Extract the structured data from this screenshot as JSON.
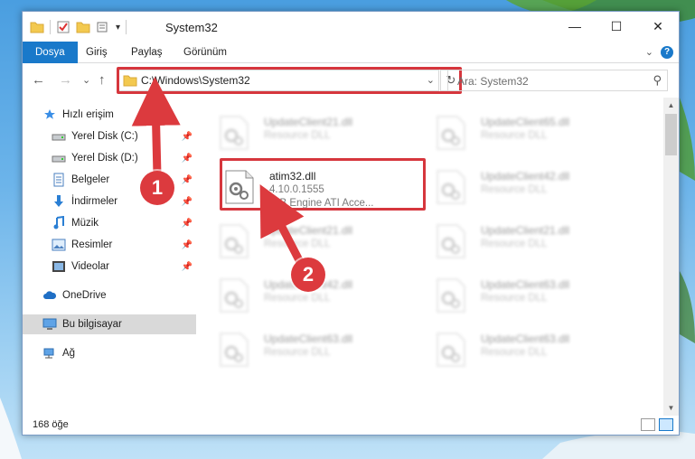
{
  "window": {
    "title": "System32",
    "minimize_glyph": "—",
    "maximize_glyph": "☐",
    "close_glyph": "✕"
  },
  "ribbon": {
    "tabs": [
      {
        "label": "Dosya",
        "active": true
      },
      {
        "label": "Giriş",
        "active": false
      },
      {
        "label": "Paylaş",
        "active": false
      },
      {
        "label": "Görünüm",
        "active": false
      }
    ],
    "help_glyph": "?",
    "expand_glyph": "⌄"
  },
  "nav": {
    "back_glyph": "←",
    "forward_glyph": "→",
    "recent_glyph": "⌄",
    "up_glyph": "↑",
    "address_path": "C:\\Windows\\System32",
    "address_dropdown_glyph": "⌄",
    "refresh_glyph": "↻",
    "search_placeholder": "Ara: System32",
    "search_glyph": "⚲"
  },
  "sidebar": {
    "items": [
      {
        "label": "Hızlı erişim",
        "icon": "star-icon",
        "pinned": false
      },
      {
        "label": "Yerel Disk (C:)",
        "icon": "drive-icon",
        "pinned": true
      },
      {
        "label": "Yerel Disk (D:)",
        "icon": "drive-icon",
        "pinned": true
      },
      {
        "label": "Belgeler",
        "icon": "documents-icon",
        "pinned": true
      },
      {
        "label": "İndirmeler",
        "icon": "download-icon",
        "pinned": true
      },
      {
        "label": "Müzik",
        "icon": "music-icon",
        "pinned": true
      },
      {
        "label": "Resimler",
        "icon": "pictures-icon",
        "pinned": true
      },
      {
        "label": "Videolar",
        "icon": "videos-icon",
        "pinned": true
      },
      {
        "label": "OneDrive",
        "icon": "cloud-icon",
        "pinned": false
      },
      {
        "label": "Bu bilgisayar",
        "icon": "computer-icon",
        "pinned": false,
        "selected": true
      },
      {
        "label": "Ağ",
        "icon": "network-icon",
        "pinned": false
      }
    ],
    "pin_glyph": "📌"
  },
  "files": {
    "highlighted": {
      "name": "atim32.dll",
      "version": "4.10.0.1555",
      "description": "DIB Engine ATI Acce..."
    },
    "blurred": [
      {
        "name": "UpdateClient21.dll",
        "type": "Resource DLL"
      },
      {
        "name": "UpdateClient65.dll",
        "type": "Resource DLL"
      },
      {
        "name": "UpdateClient42.dll",
        "type": "Resource DLL"
      },
      {
        "name": "UpdateClient21.dll",
        "type": "Resource DLL"
      },
      {
        "name": "UpdateClient21.dll",
        "type": "Resource DLL"
      },
      {
        "name": "UpdateClient42.dll",
        "type": "Resource DLL"
      },
      {
        "name": "UpdateClient63.dll",
        "type": "Resource DLL"
      },
      {
        "name": "UpdateClient63.dll",
        "type": "Resource DLL"
      },
      {
        "name": "UpdateClient63.dll",
        "type": "Resource DLL"
      }
    ]
  },
  "status": {
    "item_count": "168 öğe"
  },
  "annotations": {
    "step1": "1",
    "step2": "2",
    "color": "#dc3a3e"
  },
  "colors": {
    "accent": "#1979ca",
    "highlight": "#d6363d"
  }
}
